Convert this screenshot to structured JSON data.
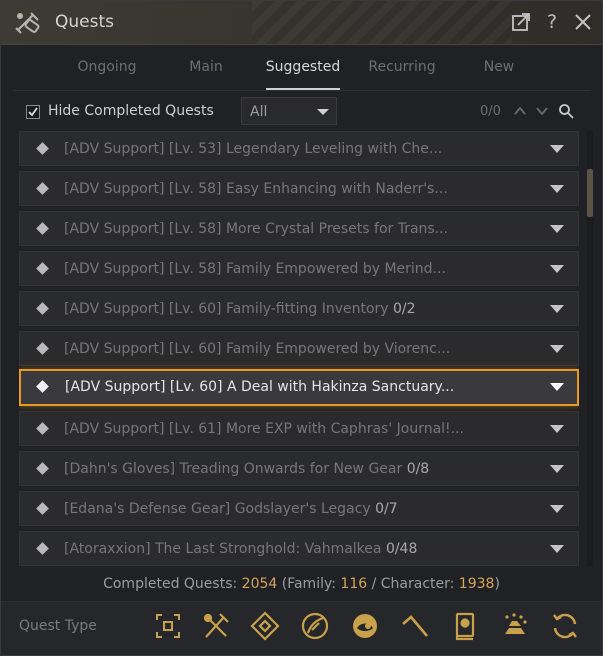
{
  "window": {
    "title": "Quests",
    "controls": [
      "popout-icon",
      "help-icon",
      "close-icon"
    ],
    "help_label": "?"
  },
  "tabs": [
    {
      "label": "Ongoing",
      "active": false
    },
    {
      "label": "Main",
      "active": false
    },
    {
      "label": "Suggested",
      "active": true
    },
    {
      "label": "Recurring",
      "active": false
    },
    {
      "label": "New",
      "active": false
    }
  ],
  "filter": {
    "hide_completed_label": "Hide Completed Quests",
    "hide_completed_checked": true,
    "dropdown_value": "All",
    "counter": "0/0"
  },
  "quests": [
    {
      "title": "[ADV Support] [Lv. 53] Legendary Leveling with Che...",
      "progress": ""
    },
    {
      "title": "[ADV Support] [Lv. 58] Easy Enhancing with Naderr's...",
      "progress": ""
    },
    {
      "title": "[ADV Support] [Lv. 58] More Crystal Presets for Trans...",
      "progress": ""
    },
    {
      "title": "[ADV Support] [Lv. 58] Family Empowered by Merind...",
      "progress": ""
    },
    {
      "title": "[ADV Support] [Lv. 60] Family-fitting Inventory ",
      "progress": "0/2"
    },
    {
      "title": "[ADV Support] [Lv. 60] Family Empowered by Viorenc...",
      "progress": ""
    },
    {
      "title": "[ADV Support] [Lv. 60] A Deal with Hakinza Sanctuary...",
      "progress": "",
      "selected": true
    },
    {
      "title": "[ADV Support] [Lv. 61] More EXP with Caphras' Journal!...",
      "progress": ""
    },
    {
      "title": "[Dahn's Gloves] Treading Onwards for New Gear ",
      "progress": "0/8"
    },
    {
      "title": "[Edana's Defense Gear] Godslayer's Legacy ",
      "progress": "0/7"
    },
    {
      "title": "[Atoraxxion] The Last Stronghold: Vahmalkea ",
      "progress": "0/48"
    }
  ],
  "summary": {
    "prefix": "Completed Quests: ",
    "total": "2054",
    "family_prefix": " (Family: ",
    "family": "116",
    "character_prefix": " / Character: ",
    "character": "1938",
    "suffix": ")"
  },
  "bottom": {
    "quest_type_label": "Quest Type",
    "icons": [
      "combat-quest-icon",
      "life-skill-quest-icon",
      "adventure-quest-icon",
      "fishing-quest-icon",
      "trade-quest-icon",
      "gathering-quest-icon",
      "knowledge-quest-icon",
      "event-quest-icon",
      "reset-filter-icon"
    ]
  },
  "colors": {
    "accent": "#e89a22",
    "gold_text": "#d3a55a",
    "icon_gold": "#c9a14a"
  }
}
